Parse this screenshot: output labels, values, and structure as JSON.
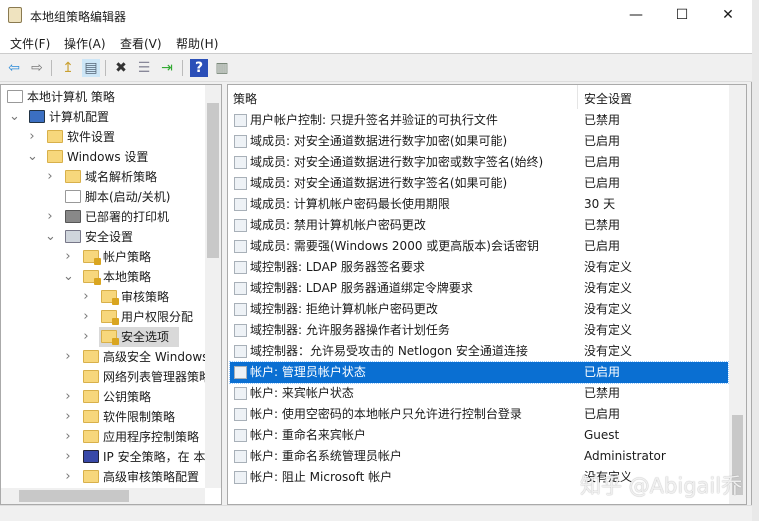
{
  "window": {
    "title": "本地组策略编辑器",
    "minimize": "—",
    "maximize": "☐",
    "close": "✕"
  },
  "menu": [
    "文件(F)",
    "操作(A)",
    "查看(V)",
    "帮助(H)"
  ],
  "toolbar": {
    "back": "⇦",
    "forward": "⇨",
    "up": "↥",
    "show_hide": "▤",
    "delete": "✖",
    "properties": "☰",
    "export": "⇥",
    "help": "?",
    "extended": "▥"
  },
  "tree": [
    {
      "label": "本地计算机 策略",
      "level": 0,
      "chev": "",
      "icon": "doc"
    },
    {
      "label": "计算机配置",
      "level": 1,
      "chev": "v",
      "icon": "pc"
    },
    {
      "label": "软件设置",
      "level": 2,
      "chev": ">",
      "icon": "folder"
    },
    {
      "label": "Windows 设置",
      "level": 2,
      "chev": "v",
      "icon": "folder"
    },
    {
      "label": "域名解析策略",
      "level": 3,
      "chev": ">",
      "icon": "folder"
    },
    {
      "label": "脚本(启动/关机)",
      "level": 3,
      "chev": "",
      "icon": "doc"
    },
    {
      "label": "已部署的打印机",
      "level": 3,
      "chev": ">",
      "icon": "print"
    },
    {
      "label": "安全设置",
      "level": 3,
      "chev": "v",
      "icon": "sec"
    },
    {
      "label": "帐户策略",
      "level": 4,
      "chev": ">",
      "icon": "lock"
    },
    {
      "label": "本地策略",
      "level": 4,
      "chev": "v",
      "icon": "lock"
    },
    {
      "label": "审核策略",
      "level": 5,
      "chev": ">",
      "icon": "lock"
    },
    {
      "label": "用户权限分配",
      "level": 5,
      "chev": ">",
      "icon": "lock"
    },
    {
      "label": "安全选项",
      "level": 5,
      "chev": ">",
      "icon": "lock",
      "selected": true
    },
    {
      "label": "高级安全 Windows",
      "level": 4,
      "chev": ">",
      "icon": "folder"
    },
    {
      "label": "网络列表管理器策略",
      "level": 4,
      "chev": "",
      "icon": "folder"
    },
    {
      "label": "公钥策略",
      "level": 4,
      "chev": ">",
      "icon": "folder"
    },
    {
      "label": "软件限制策略",
      "level": 4,
      "chev": ">",
      "icon": "folder"
    },
    {
      "label": "应用程序控制策略",
      "level": 4,
      "chev": ">",
      "icon": "folder"
    },
    {
      "label": "IP 安全策略，在 本",
      "level": 4,
      "chev": ">",
      "icon": "ip"
    },
    {
      "label": "高级审核策略配置",
      "level": 4,
      "chev": ">",
      "icon": "folder"
    }
  ],
  "list": {
    "col_policy": "策略",
    "col_setting": "安全设置",
    "sort_indicator": "^",
    "rows": [
      {
        "name": "用户帐户控制: 只提升签名并验证的可执行文件",
        "value": "已禁用"
      },
      {
        "name": "域成员: 对安全通道数据进行数字加密(如果可能)",
        "value": "已启用"
      },
      {
        "name": "域成员: 对安全通道数据进行数字加密或数字签名(始终)",
        "value": "已启用"
      },
      {
        "name": "域成员: 对安全通道数据进行数字签名(如果可能)",
        "value": "已启用"
      },
      {
        "name": "域成员: 计算机帐户密码最长使用期限",
        "value": "30 天"
      },
      {
        "name": "域成员: 禁用计算机帐户密码更改",
        "value": "已禁用"
      },
      {
        "name": "域成员: 需要强(Windows 2000 或更高版本)会话密钥",
        "value": "已启用"
      },
      {
        "name": "域控制器: LDAP 服务器签名要求",
        "value": "没有定义"
      },
      {
        "name": "域控制器: LDAP 服务器通道绑定令牌要求",
        "value": "没有定义"
      },
      {
        "name": "域控制器: 拒绝计算机帐户密码更改",
        "value": "没有定义"
      },
      {
        "name": "域控制器: 允许服务器操作者计划任务",
        "value": "没有定义"
      },
      {
        "name": "域控制器：允许易受攻击的 Netlogon 安全通道连接",
        "value": "没有定义"
      },
      {
        "name": "帐户: 管理员帐户状态",
        "value": "已启用",
        "selected": true
      },
      {
        "name": "帐户: 来宾帐户状态",
        "value": "已禁用"
      },
      {
        "name": "帐户: 使用空密码的本地帐户只允许进行控制台登录",
        "value": "已启用"
      },
      {
        "name": "帐户: 重命名来宾帐户",
        "value": "Guest"
      },
      {
        "name": "帐户: 重命名系统管理员帐户",
        "value": "Administrator"
      },
      {
        "name": "帐户: 阻止 Microsoft 帐户",
        "value": "没有定义"
      }
    ]
  },
  "watermark": "知乎 @Abigail乔",
  "colors": {
    "selection": "#0a6fd2"
  }
}
